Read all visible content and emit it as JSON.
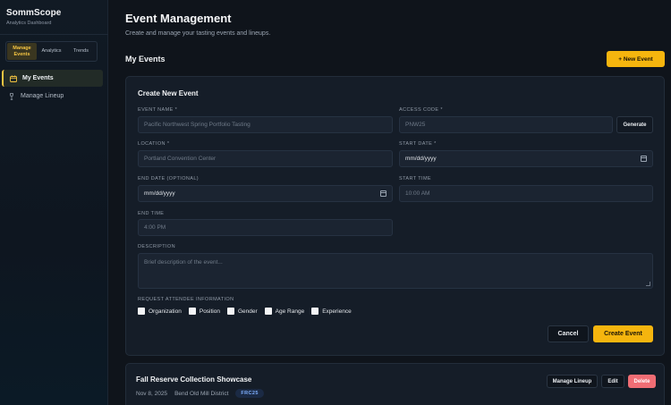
{
  "sidebar": {
    "brand_title": "SommScope",
    "brand_subtitle": "Analytics Dashboard",
    "segments": [
      {
        "label": "Manage Events",
        "active": true
      },
      {
        "label": "Analytics",
        "active": false
      },
      {
        "label": "Trends",
        "active": false
      }
    ],
    "nav": [
      {
        "label": "My Events",
        "icon": "calendar-icon",
        "active": true
      },
      {
        "label": "Manage Lineup",
        "icon": "wine-glass-icon",
        "active": false
      }
    ]
  },
  "header": {
    "title": "Event Management",
    "subtitle": "Create and manage your tasting events and lineups."
  },
  "events_section": {
    "title": "My Events",
    "new_event_label": "+ New Event"
  },
  "form": {
    "title": "Create New Event",
    "event_name": {
      "label": "Event Name *",
      "placeholder": "Pacific Northwest Spring Portfolio Tasting"
    },
    "access_code": {
      "label": "Access Code *",
      "placeholder": "PNW25",
      "generate_label": "Generate"
    },
    "location": {
      "label": "Location *",
      "placeholder": "Portland Convention Center"
    },
    "start_date": {
      "label": "Start Date *",
      "value": "mm/dd/yyyy"
    },
    "end_date": {
      "label": "End Date (Optional)",
      "value": "mm/dd/yyyy"
    },
    "start_time": {
      "label": "Start Time",
      "placeholder": "10:00 AM"
    },
    "end_time": {
      "label": "End Time",
      "placeholder": "4:00 PM"
    },
    "description": {
      "label": "Description",
      "placeholder": "Brief description of the event..."
    },
    "attendee_info": {
      "label": "Request Attendee Information",
      "options": [
        "Organization",
        "Position",
        "Gender",
        "Age Range",
        "Experience"
      ]
    },
    "cancel_label": "Cancel",
    "create_label": "Create Event"
  },
  "event_list": [
    {
      "title": "Fall Reserve Collection Showcase",
      "date": "Nov 8, 2025",
      "location": "Bend Old Mill District",
      "code": "FRC25",
      "actions": {
        "lineup": "Manage Lineup",
        "edit": "Edit",
        "delete": "Delete"
      }
    }
  ],
  "colors": {
    "accent": "#f5b50e",
    "danger": "#f06d74",
    "background": "#0f141b",
    "card": "#151d28"
  }
}
